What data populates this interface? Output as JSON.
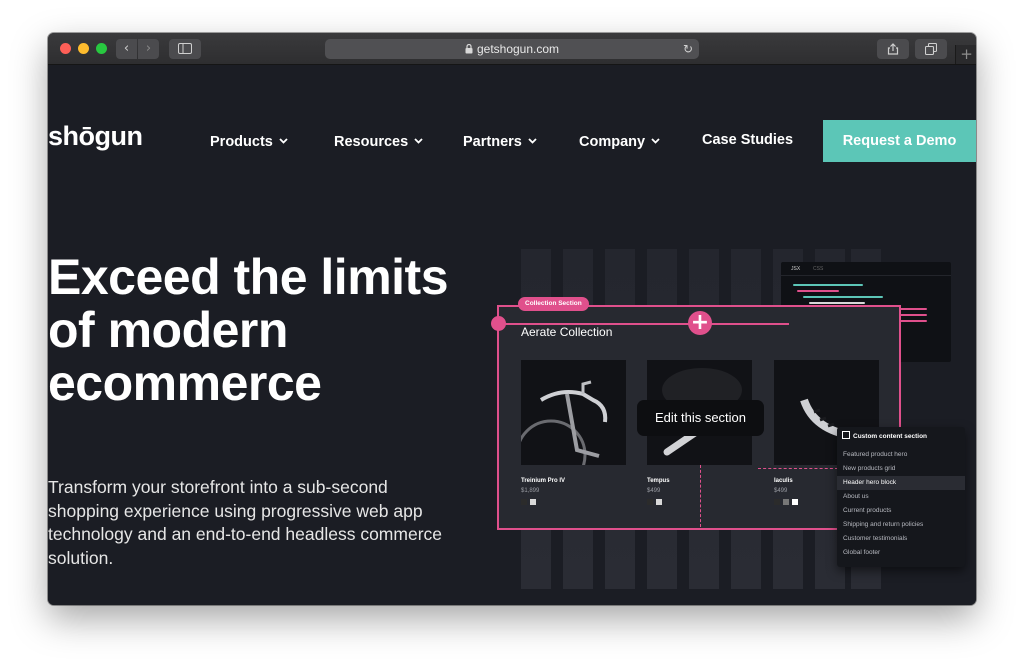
{
  "browser": {
    "url": "getshogun.com",
    "nav_back": "‹",
    "nav_forward": "›",
    "reload": "↻",
    "new_tab": "+"
  },
  "nav": {
    "logo": "shōgun",
    "items": [
      {
        "label": "Products",
        "has_dropdown": true
      },
      {
        "label": "Resources",
        "has_dropdown": true
      },
      {
        "label": "Partners",
        "has_dropdown": true
      },
      {
        "label": "Company",
        "has_dropdown": true
      },
      {
        "label": "Case Studies",
        "has_dropdown": false
      }
    ],
    "cta": "Request a Demo"
  },
  "hero": {
    "title": "Exceed the limits of modern ecommerce",
    "subtitle": "Transform your storefront into a sub-second shopping experience using progressive web app technology and an end-to-end headless commerce solution."
  },
  "illustration": {
    "section_badge": "Collection Section",
    "collection_title": "Aerate Collection",
    "add_icon": "+",
    "edit_label": "Edit this section",
    "code_tabs": [
      "JSX",
      "CSS"
    ],
    "products": [
      {
        "name": "Treinium Pro IV",
        "price": "$1,899",
        "swatches": [
          "#2b2b2b",
          "#d9d9d9"
        ]
      },
      {
        "name": "Tempus",
        "price": "$499",
        "swatches": [
          "#2b2b2b",
          "#d9d9d9"
        ]
      },
      {
        "name": "Iaculis",
        "price": "$499",
        "swatches": [
          "#2b2b2b",
          "#777777",
          "#ffffff"
        ]
      }
    ],
    "dropdown": {
      "header": "Custom content section",
      "items": [
        "Featured product hero",
        "New products grid",
        "Header hero block",
        "About us",
        "Current products",
        "Shipping and return policies",
        "Customer testimonials",
        "Global footer"
      ],
      "selected": "Header hero block"
    }
  },
  "colors": {
    "accent_teal": "#5cc6b7",
    "accent_pink": "#e0508c",
    "background": "#1b1d24"
  }
}
